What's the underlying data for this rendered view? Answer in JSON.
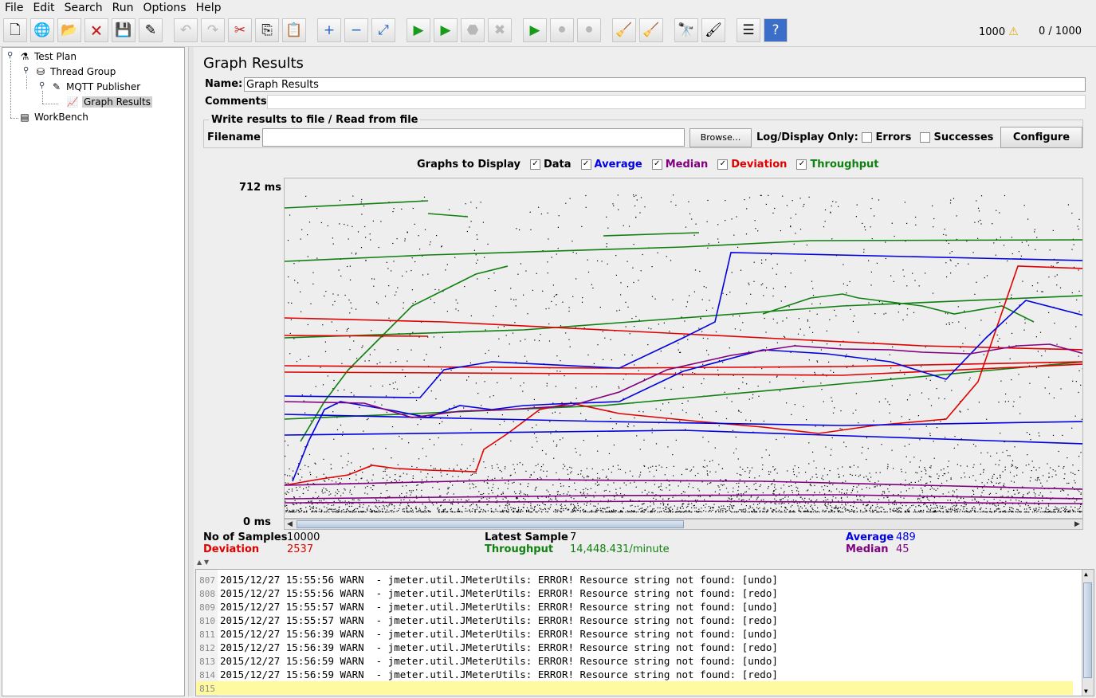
{
  "menu": [
    "File",
    "Edit",
    "Search",
    "Run",
    "Options",
    "Help"
  ],
  "toolbar": {
    "buttons": [
      {
        "name": "new-icon",
        "glyph": "🗋",
        "disabled": false
      },
      {
        "name": "templates-icon",
        "glyph": "🌐",
        "disabled": false
      },
      {
        "name": "open-icon",
        "glyph": "📂",
        "disabled": false
      },
      {
        "name": "close-icon",
        "glyph": "🗙",
        "disabled": false
      },
      {
        "name": "save-icon",
        "glyph": "💾",
        "disabled": false
      },
      {
        "name": "save-as-icon",
        "glyph": "✎",
        "disabled": false
      },
      {
        "name": "undo-icon",
        "glyph": "↶",
        "disabled": true
      },
      {
        "name": "redo-icon",
        "glyph": "↷",
        "disabled": true
      },
      {
        "name": "cut-icon",
        "glyph": "✂",
        "disabled": false
      },
      {
        "name": "copy-icon",
        "glyph": "⎘",
        "disabled": false
      },
      {
        "name": "paste-icon",
        "glyph": "📋",
        "disabled": false
      },
      {
        "name": "expand-icon",
        "glyph": "+",
        "disabled": false
      },
      {
        "name": "collapse-icon",
        "glyph": "−",
        "disabled": false
      },
      {
        "name": "toggle-icon",
        "glyph": "⤢",
        "disabled": false
      },
      {
        "name": "start-icon",
        "glyph": "▶",
        "disabled": false
      },
      {
        "name": "start-no-pause-icon",
        "glyph": "▶",
        "disabled": false
      },
      {
        "name": "stop-icon",
        "glyph": "⬣",
        "disabled": true
      },
      {
        "name": "shutdown-icon",
        "glyph": "✖",
        "disabled": true
      },
      {
        "name": "remote-start-icon",
        "glyph": "▶",
        "disabled": false
      },
      {
        "name": "remote-stop-icon",
        "glyph": "⚫",
        "disabled": true
      },
      {
        "name": "remote-shutdown-icon",
        "glyph": "⚫",
        "disabled": true
      },
      {
        "name": "clear-icon",
        "glyph": "🧹",
        "disabled": false
      },
      {
        "name": "clear-all-icon",
        "glyph": "🧹",
        "disabled": false
      },
      {
        "name": "search-icon",
        "glyph": "🔭",
        "disabled": false
      },
      {
        "name": "reset-search-icon",
        "glyph": "🖌",
        "disabled": false
      },
      {
        "name": "function-helper-icon",
        "glyph": "☰",
        "disabled": false
      },
      {
        "name": "help-icon",
        "glyph": "?",
        "disabled": false
      }
    ],
    "error_count": "1000",
    "warn_icon": "warning-icon",
    "active_threads": "0 / 1000"
  },
  "tree": {
    "nodes": [
      {
        "label": "Test Plan",
        "icon": "test-plan-icon"
      },
      {
        "label": "Thread Group",
        "icon": "thread-group-icon"
      },
      {
        "label": "MQTT Publisher",
        "icon": "sampler-icon"
      },
      {
        "label": "Graph Results",
        "icon": "graph-results-icon"
      },
      {
        "label": "WorkBench",
        "icon": "workbench-icon"
      }
    ]
  },
  "panel": {
    "title": "Graph Results",
    "name_label": "Name:",
    "name_value": "Graph Results",
    "comments_label": "Comments:",
    "file_legend": "Write results to file / Read from file",
    "filename_label": "Filename",
    "browse_label": "Browse...",
    "log_display_label": "Log/Display Only:",
    "errors_label": "Errors",
    "successes_label": "Successes",
    "configure_label": "Configure",
    "graphs_label": "Graphs to Display",
    "graph_options": [
      {
        "label": "Data",
        "color": "#000000",
        "checked": true
      },
      {
        "label": "Average",
        "color": "#0000e0",
        "checked": true
      },
      {
        "label": "Median",
        "color": "#800080",
        "checked": true
      },
      {
        "label": "Deviation",
        "color": "#e00000",
        "checked": true
      },
      {
        "label": "Throughput",
        "color": "#108010",
        "checked": true
      }
    ]
  },
  "chart_data": {
    "type": "line",
    "ylabel_top": "712 ms",
    "ylabel_bottom": "0 ms",
    "ylim": [
      0,
      712
    ],
    "series_colors": {
      "data": "#000000",
      "average": "#0000e0",
      "median": "#800080",
      "deviation": "#e00000",
      "throughput": "#108010"
    }
  },
  "stats": {
    "samples_label": "No of Samples",
    "samples_value": "10000",
    "deviation_label": "Deviation",
    "deviation_value": "2537",
    "latest_label": "Latest Sample",
    "latest_value": "7",
    "throughput_label": "Throughput",
    "throughput_value": "14,448.431/minute",
    "average_label": "Average",
    "average_value": "489",
    "median_label": "Median",
    "median_value": "45"
  },
  "log": {
    "lines": [
      {
        "num": "807",
        "text": "2015/12/27 15:55:56 WARN  - jmeter.util.JMeterUtils: ERROR! Resource string not found: [undo]"
      },
      {
        "num": "808",
        "text": "2015/12/27 15:55:56 WARN  - jmeter.util.JMeterUtils: ERROR! Resource string not found: [redo]"
      },
      {
        "num": "809",
        "text": "2015/12/27 15:55:57 WARN  - jmeter.util.JMeterUtils: ERROR! Resource string not found: [undo]"
      },
      {
        "num": "810",
        "text": "2015/12/27 15:55:57 WARN  - jmeter.util.JMeterUtils: ERROR! Resource string not found: [redo]"
      },
      {
        "num": "811",
        "text": "2015/12/27 15:56:39 WARN  - jmeter.util.JMeterUtils: ERROR! Resource string not found: [undo]"
      },
      {
        "num": "812",
        "text": "2015/12/27 15:56:39 WARN  - jmeter.util.JMeterUtils: ERROR! Resource string not found: [redo]"
      },
      {
        "num": "813",
        "text": "2015/12/27 15:56:59 WARN  - jmeter.util.JMeterUtils: ERROR! Resource string not found: [undo]"
      },
      {
        "num": "814",
        "text": "2015/12/27 15:56:59 WARN  - jmeter.util.JMeterUtils: ERROR! Resource string not found: [redo]"
      },
      {
        "num": "815",
        "text": ""
      }
    ]
  }
}
